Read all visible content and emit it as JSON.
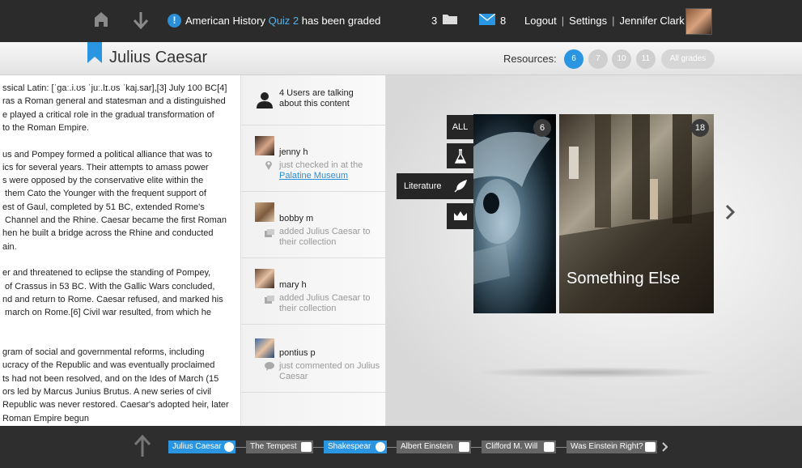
{
  "topbar": {
    "notification_prefix": "American History ",
    "notification_link": "Quiz 2",
    "notification_suffix": " has been graded",
    "folder_count": "3",
    "mail_count": "8",
    "logout": "Logout",
    "separator": "|",
    "settings": "Settings",
    "user_name": "Jennifer Clark"
  },
  "header": {
    "title": "Julius Caesar",
    "resources_label": "Resources:",
    "resource_grades": [
      "6",
      "7",
      "10",
      "11"
    ],
    "all_grades": "All grades"
  },
  "article": {
    "lines": [
      "ssical Latin: [ˈɡaː.i.ʊs ˈjuː.lɪ.ʊs ˈkaj.sar],[3] July 100 BC[4]",
      "ras a Roman general and statesman and a distinguished",
      "e played a critical role in the gradual transformation of",
      "to the Roman Empire.",
      "",
      "us and Pompey formed a political alliance that was to",
      "ics for several years. Their attempts to amass power",
      "s were opposed by the conservative elite within the",
      " them Cato the Younger with the frequent support of",
      "est of Gaul, completed by 51 BC, extended Rome's",
      " Channel and the Rhine. Caesar became the first Roman",
      "hen he built a bridge across the Rhine and conducted",
      "ain.",
      "",
      "er and threatened to eclipse the standing of Pompey,",
      " of Crassus in 53 BC. With the Gallic Wars concluded,",
      "nd and return to Rome. Caesar refused, and marked his",
      " march on Rome.[6] Civil war resulted, from which he",
      "",
      "",
      "gram of social and governmental reforms, including",
      "ucracy of the Republic and was eventually proclaimed",
      "ts had not been resolved, and on the Ides of March (15",
      "ors led by Marcus Junius Brutus. A new series of civil",
      "Republic was never restored. Caesar's adopted heir, later",
      "Roman Empire begun"
    ]
  },
  "activity": {
    "header": "4 Users are talking about this content",
    "items": [
      {
        "name": "jenny h",
        "action": "just checked in at the",
        "link": "Palatine Museum",
        "icon": "map-pin-icon"
      },
      {
        "name": "bobby m",
        "action": "added Julius Caesar to their collection",
        "icon": "collection-icon"
      },
      {
        "name": "mary h",
        "action": "added Julius Caesar to their collection",
        "icon": "collection-icon"
      },
      {
        "name": "pontius p",
        "action": "just commented on Julius Caesar",
        "icon": "comment-icon"
      }
    ]
  },
  "gallery": {
    "filters": {
      "all": "ALL",
      "literature": "Literature"
    },
    "filter_icons": [
      "flask-icon",
      "quill-icon",
      "crown-icon"
    ],
    "cards": [
      {
        "badge": "6",
        "label": ""
      },
      {
        "badge": "18",
        "label": "Something Else"
      }
    ]
  },
  "trail": {
    "items": [
      {
        "label": "Julius Caesar",
        "style": "blue",
        "icon": "arrow-right-icon"
      },
      {
        "label": "The Tempest",
        "style": "grey",
        "icon": "book-icon"
      },
      {
        "label": "Shakespear",
        "style": "blue",
        "icon": "arrow-right-icon"
      },
      {
        "label": "Albert Einstein",
        "style": "grey",
        "icon": "book-icon"
      },
      {
        "label": "Clifford M. Will",
        "style": "grey",
        "icon": "book-icon"
      },
      {
        "label": "Was Einstein Right?",
        "style": "grey",
        "icon": "book-icon"
      }
    ]
  },
  "colors": {
    "accent": "#2a95e0",
    "topbar": "#2b2b2b"
  }
}
